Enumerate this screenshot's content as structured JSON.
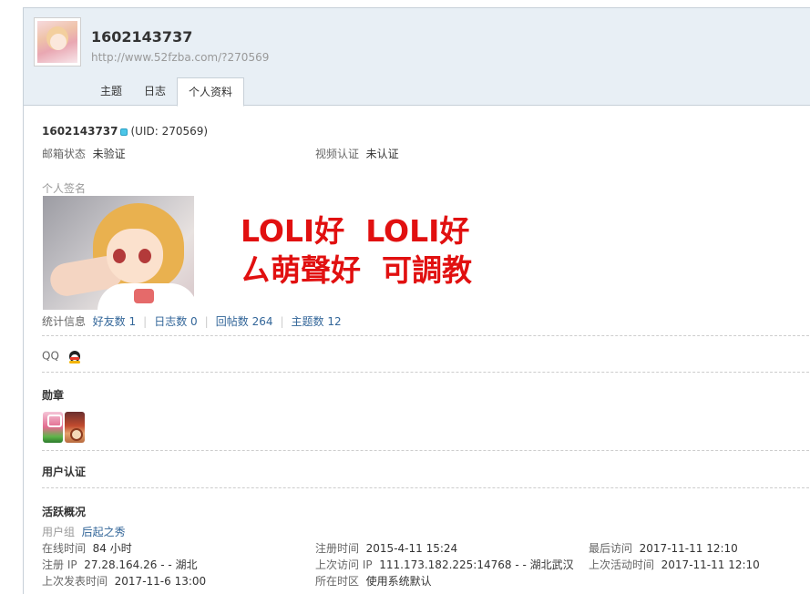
{
  "header": {
    "username": "1602143737",
    "url": "http://www.52fzba.com/?270569",
    "tabs": [
      {
        "label": "主题",
        "active": false
      },
      {
        "label": "日志",
        "active": false
      },
      {
        "label": "个人资料",
        "active": true
      }
    ]
  },
  "profile": {
    "name": "1602143737",
    "uid": "(UID: 270569)",
    "email_status_label": "邮箱状态",
    "email_status_value": "未验证",
    "video_label": "视频认证",
    "video_value": "未认证",
    "signature_label": "个人签名",
    "signature_text": "LOLI好  LOLI好\nㄙ萌聲好  可調教",
    "stats_label": "统计信息",
    "stats": [
      {
        "label": "好友数",
        "value": "1"
      },
      {
        "label": "日志数",
        "value": "0"
      },
      {
        "label": "回帖数",
        "value": "264"
      },
      {
        "label": "主题数",
        "value": "12"
      }
    ],
    "qq_label": "QQ"
  },
  "sections": {
    "medals": "勋章",
    "verification": "用户认证",
    "activity": "活跃概况"
  },
  "activity": {
    "group_label": "用户组",
    "group_value": "后起之秀",
    "online_label": "在线时间",
    "online_value": "84 小时",
    "reg_time_label": "注册时间",
    "reg_time_value": "2015-4-11 15:24",
    "last_visit_label": "最后访问",
    "last_visit_value": "2017-11-11 12:10",
    "reg_ip_label": "注册 IP",
    "reg_ip_value": "27.28.164.26 - - 湖北",
    "last_ip_label": "上次访问 IP",
    "last_ip_value": "111.173.182.225:14768 - - 湖北武汉",
    "last_active_label": "上次活动时间",
    "last_active_value": "2017-11-11 12:10",
    "last_post_label": "上次发表时间",
    "last_post_value": "2017-11-6 13:00",
    "timezone_label": "所在时区",
    "timezone_value": "使用系统默认"
  },
  "colors": {
    "header_bg": "#e8eff5",
    "signature_red": "#e11010",
    "link_blue": "#336699"
  }
}
